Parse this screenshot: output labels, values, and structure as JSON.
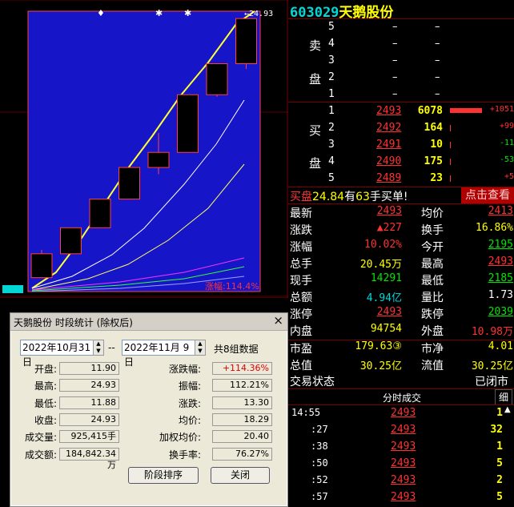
{
  "chart": {
    "high_label": "←24.93",
    "change_label": "涨幅:114.4%",
    "candles": [
      {
        "o": 11.9,
        "c": 13.1,
        "h": 13.3,
        "l": 11.88,
        "dir": "up"
      },
      {
        "o": 13.1,
        "c": 14.41,
        "h": 14.41,
        "l": 13.1,
        "dir": "up"
      },
      {
        "o": 14.41,
        "c": 15.85,
        "h": 15.85,
        "l": 14.41,
        "dir": "up"
      },
      {
        "o": 15.85,
        "c": 17.44,
        "h": 17.44,
        "l": 15.85,
        "dir": "up"
      },
      {
        "o": 17.44,
        "c": 18.2,
        "h": 19.18,
        "l": 17.1,
        "dir": "up"
      },
      {
        "o": 18.2,
        "c": 21.1,
        "h": 21.1,
        "l": 18.2,
        "dir": "up"
      },
      {
        "o": 21.1,
        "c": 22.66,
        "h": 22.66,
        "l": 21.0,
        "dir": "up"
      },
      {
        "o": 22.66,
        "c": 24.93,
        "h": 24.93,
        "l": 22.4,
        "dir": "up"
      }
    ]
  },
  "quote": {
    "code": "603029",
    "name": "天鹅股份",
    "sell_label": [
      "卖",
      "盘"
    ],
    "buy_label": [
      "买",
      "盘"
    ],
    "sell": [
      {
        "lv": "5",
        "price": "–",
        "vol": "–"
      },
      {
        "lv": "4",
        "price": "–",
        "vol": "–"
      },
      {
        "lv": "3",
        "price": "–",
        "vol": "–"
      },
      {
        "lv": "2",
        "price": "–",
        "vol": "–"
      },
      {
        "lv": "1",
        "price": "–",
        "vol": "–"
      }
    ],
    "buy": [
      {
        "lv": "1",
        "price": "2493",
        "vol": "6078",
        "chg": "+1051",
        "bar": 1.0
      },
      {
        "lv": "2",
        "price": "2492",
        "vol": "164",
        "chg": "+99",
        "bar": 0.03
      },
      {
        "lv": "3",
        "price": "2491",
        "vol": "10",
        "chg": "-11",
        "bar": 0.0
      },
      {
        "lv": "4",
        "price": "2490",
        "vol": "175",
        "chg": "-53",
        "bar": 0.03
      },
      {
        "lv": "5",
        "price": "2489",
        "vol": "23",
        "chg": "+5",
        "bar": 0.0
      }
    ],
    "notice": {
      "prefix": "买盘",
      "price": "24.84",
      "mid": "有",
      "count": "63",
      "suffix": "手买单!"
    },
    "check_btn": "点击查看",
    "stats": [
      {
        "l1": "最新",
        "v1": "2493",
        "l2": "均价",
        "v2": "2413"
      },
      {
        "l1": "涨跌",
        "v1": "▲227",
        "l2": "换手",
        "v2": "16.86%"
      },
      {
        "l1": "涨幅",
        "v1": "10.02%",
        "l2": "今开",
        "v2": "2195"
      },
      {
        "l1": "总手",
        "v1": "20.45万",
        "l2": "最高",
        "v2": "2493"
      },
      {
        "l1": "现手",
        "v1": "14291",
        "l2": "最低",
        "v2": "2185"
      },
      {
        "l1": "总额",
        "v1": "4.94亿",
        "l2": "量比",
        "v2": "1.73"
      },
      {
        "l1": "涨停",
        "v1": "2493",
        "l2": "跌停",
        "v2": "2039"
      },
      {
        "l1": "内盘",
        "v1": "94754",
        "l2": "外盘",
        "v2": "10.98万"
      }
    ],
    "stats2": [
      {
        "l1": "市盈",
        "v1": "179.63③",
        "l2": "市净",
        "v2": "4.01"
      },
      {
        "l1": "总值",
        "v1": "30.25亿",
        "l2": "流值",
        "v2": "30.25亿"
      }
    ],
    "status_label": "交易状态",
    "status_value": "已闭市",
    "ticks_header": "分时成交",
    "ticks_tab": "细",
    "ticks": [
      {
        "t": "14:55",
        "p": "2493",
        "v": "1"
      },
      {
        "t": ":27",
        "p": "2493",
        "v": "32"
      },
      {
        "t": ":38",
        "p": "2493",
        "v": "1"
      },
      {
        "t": ":50",
        "p": "2493",
        "v": "5"
      },
      {
        "t": ":52",
        "p": "2493",
        "v": "2"
      },
      {
        "t": ":57",
        "p": "2493",
        "v": "5"
      }
    ]
  },
  "dialog": {
    "title": "天鹅股份  时段统计 (除权后)",
    "date_from": "2022年10月31日",
    "sep": "--",
    "date_to": "2022年11月  9日",
    "groups": "共8组数据",
    "left": [
      {
        "label": "开盘:",
        "value": "11.90"
      },
      {
        "label": "最高:",
        "value": "24.93"
      },
      {
        "label": "最低:",
        "value": "11.88"
      },
      {
        "label": "收盘:",
        "value": "24.93"
      },
      {
        "label": "成交量:",
        "value": "925,415手"
      },
      {
        "label": "成交额:",
        "value": "184,842.34万"
      }
    ],
    "right": [
      {
        "label": "涨跌幅:",
        "value": "+114.36%"
      },
      {
        "label": "振幅:",
        "value": "112.21%"
      },
      {
        "label": "涨跌:",
        "value": "13.30"
      },
      {
        "label": "均价:",
        "value": "18.29"
      },
      {
        "label": "加权均价:",
        "value": "20.40"
      },
      {
        "label": "换手率:",
        "value": "76.27%"
      }
    ],
    "btn_sort": "阶段排序",
    "btn_close": "关闭"
  }
}
